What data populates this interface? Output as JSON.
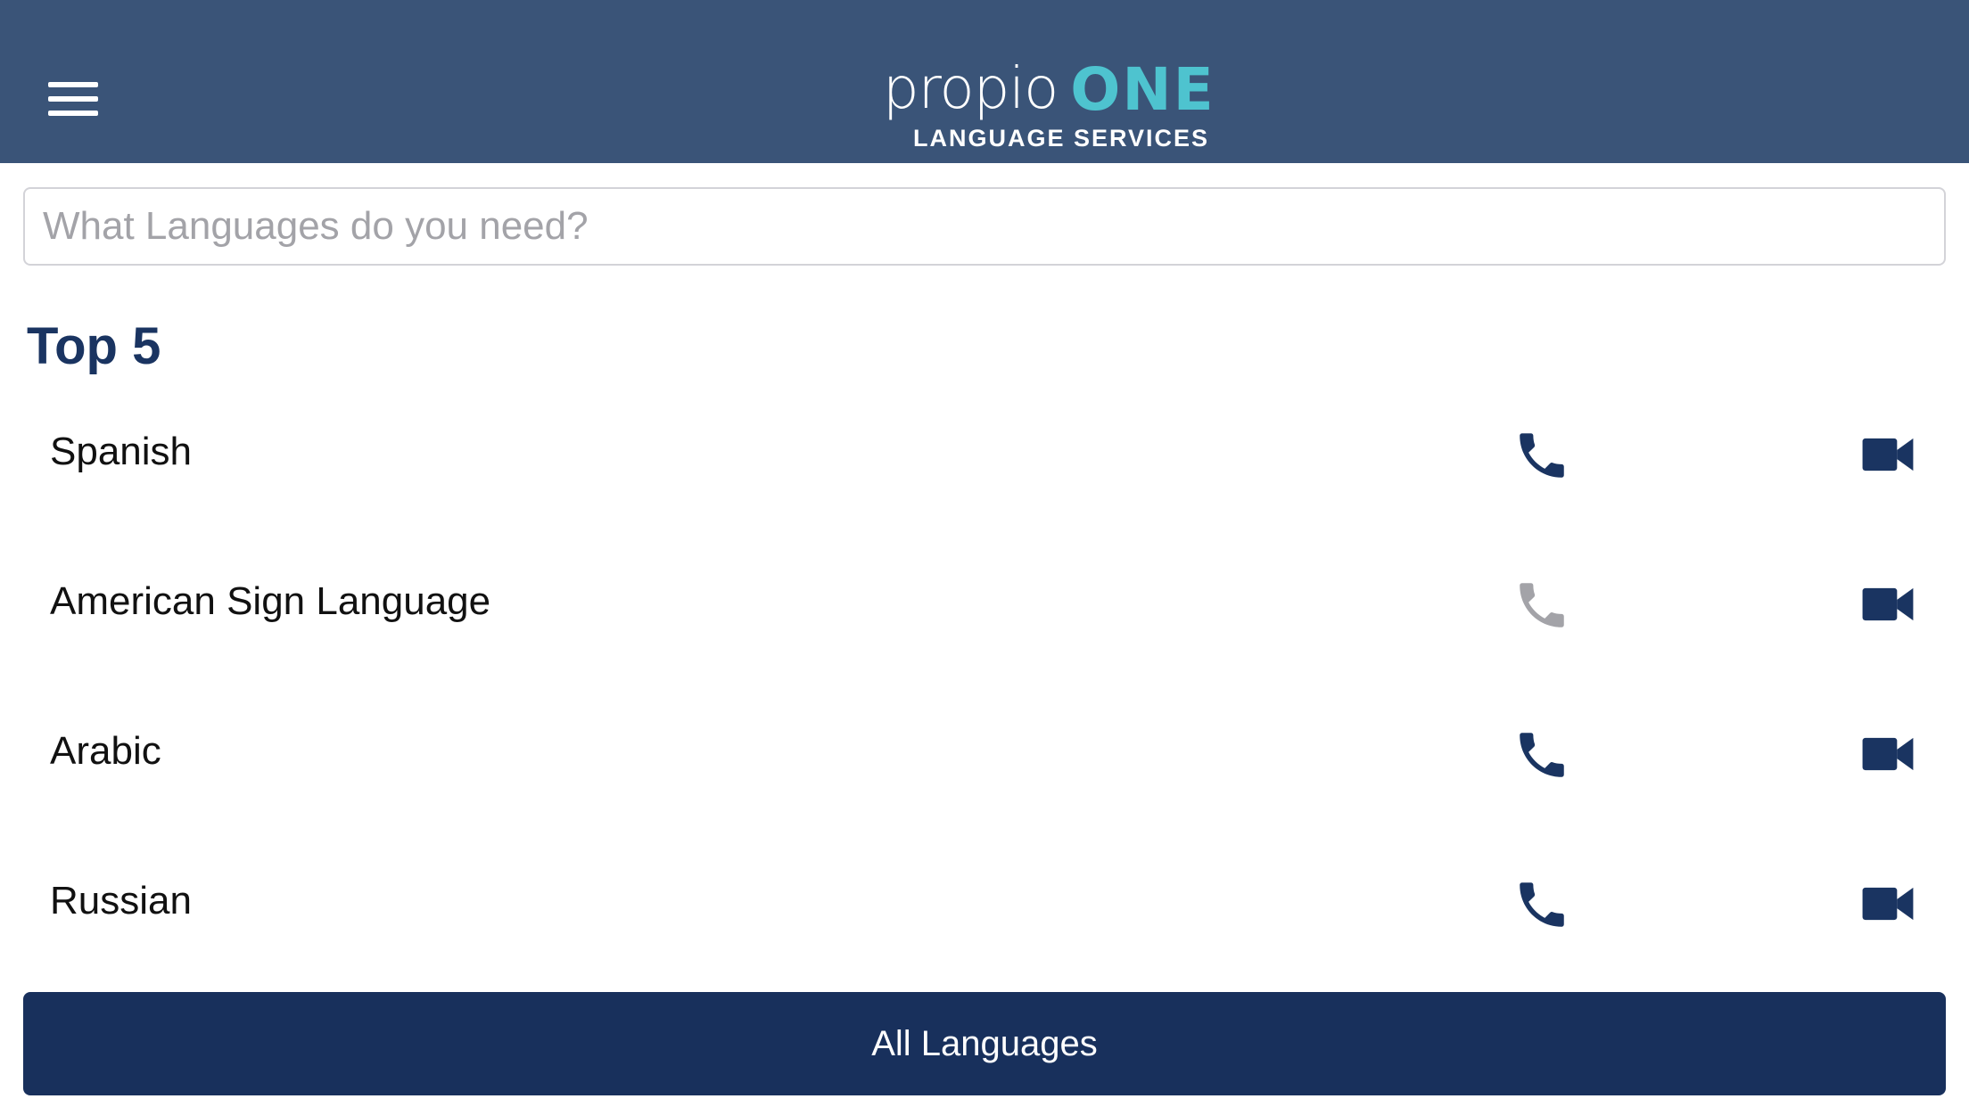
{
  "header": {
    "logo_main": "propio",
    "logo_accent": "ONE",
    "logo_sub": "LANGUAGE SERVICES",
    "menu_icon": "hamburger-menu-icon",
    "background_color": "#3a5478",
    "accent_color": "#4ec3cf"
  },
  "search": {
    "placeholder": "What Languages do you need?",
    "value": ""
  },
  "top5": {
    "title": "Top 5",
    "items": [
      {
        "label": "Spanish",
        "phone_enabled": true,
        "video_enabled": true
      },
      {
        "label": "American Sign Language",
        "phone_enabled": false,
        "video_enabled": true
      },
      {
        "label": "Arabic",
        "phone_enabled": true,
        "video_enabled": true
      },
      {
        "label": "Russian",
        "phone_enabled": true,
        "video_enabled": true
      }
    ],
    "icon_color": "#1a3461",
    "disabled_icon_color": "#a3a3a8"
  },
  "footer": {
    "all_languages_label": "All Languages",
    "button_color": "#18305c"
  }
}
